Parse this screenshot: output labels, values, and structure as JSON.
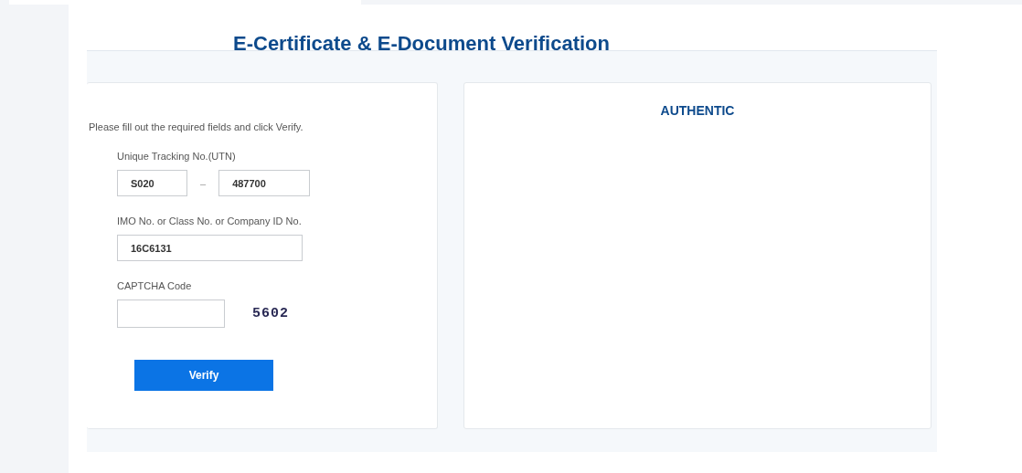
{
  "title": "E-Certificate & E-Document Verification",
  "form": {
    "instruction": "Please fill out the required fields and click Verify.",
    "utn": {
      "label": "Unique Tracking No.(UTN)",
      "prefix": "S020",
      "separator": "–",
      "number": "487700"
    },
    "id_field": {
      "label": "IMO No. or Class No. or Company ID No.",
      "value": "16C6131"
    },
    "captcha": {
      "label": "CAPTCHA Code",
      "image_text": "5602"
    },
    "button": "Verify"
  },
  "result": {
    "status": "AUTHENTIC"
  }
}
